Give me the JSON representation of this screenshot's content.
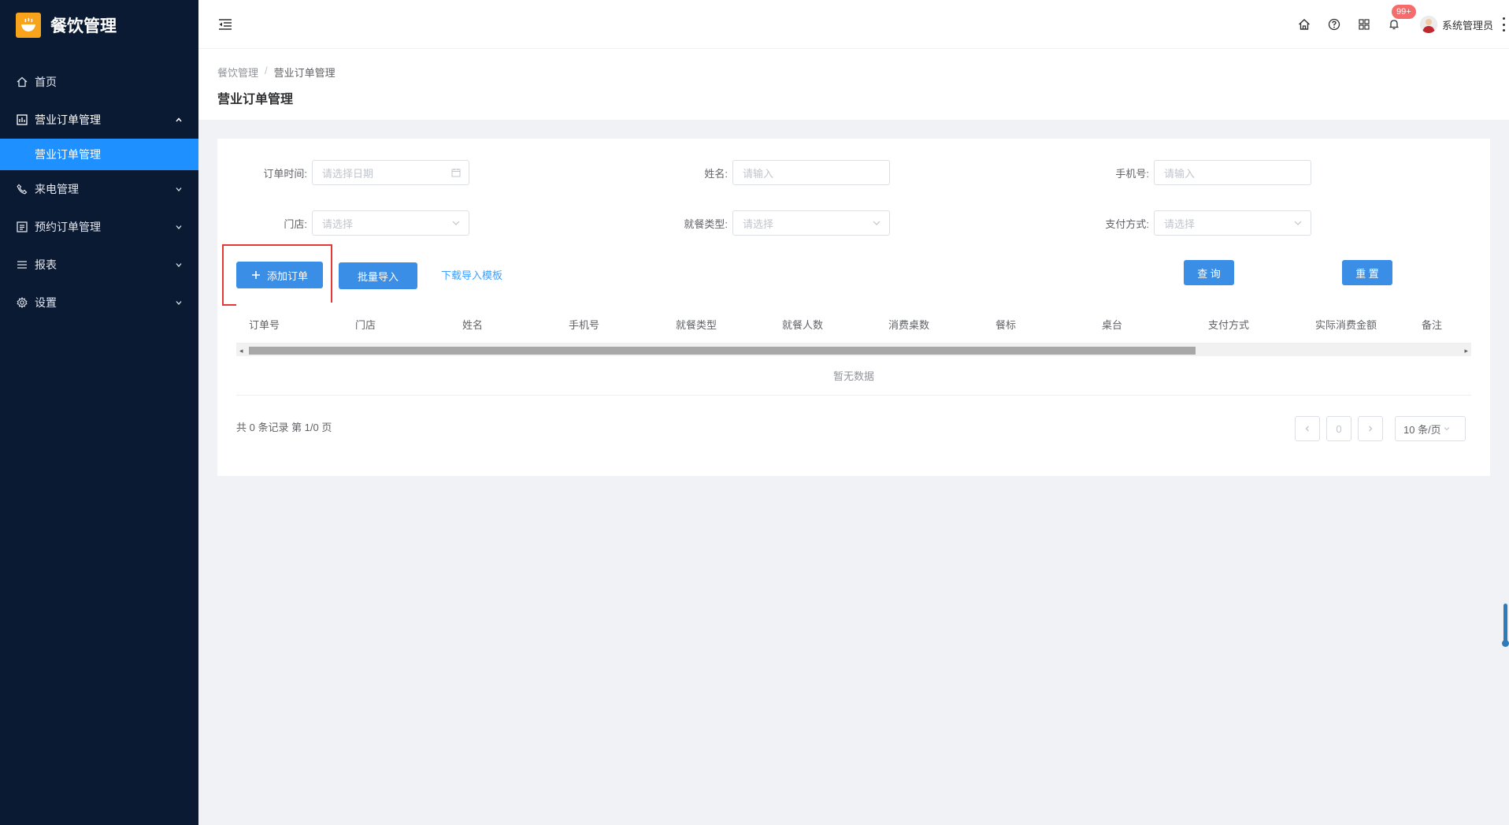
{
  "app": {
    "name": "餐饮管理"
  },
  "sidebar": {
    "items": [
      {
        "label": "首页",
        "icon": "home-icon"
      },
      {
        "label": "营业订单管理",
        "icon": "chart-icon",
        "expanded": true
      },
      {
        "label": "营业订单管理",
        "sub": true,
        "active": true
      },
      {
        "label": "来电管理",
        "icon": "phone-icon"
      },
      {
        "label": "预约订单管理",
        "icon": "list-icon"
      },
      {
        "label": "报表",
        "icon": "menu-icon"
      },
      {
        "label": "设置",
        "icon": "gear-icon"
      }
    ]
  },
  "header": {
    "notification_badge": "99+",
    "username": "系统管理员"
  },
  "breadcrumb": {
    "root": "餐饮管理",
    "separator": "/",
    "current": "营业订单管理"
  },
  "page": {
    "title": "营业订单管理"
  },
  "filters": {
    "order_time_label": "订单时间:",
    "order_time_placeholder": "请选择日期",
    "name_label": "姓名:",
    "name_placeholder": "请输入",
    "phone_label": "手机号:",
    "phone_placeholder": "请输入",
    "store_label": "门店:",
    "store_placeholder": "请选择",
    "dining_type_label": "就餐类型:",
    "dining_type_placeholder": "请选择",
    "payment_label": "支付方式:",
    "payment_placeholder": "请选择"
  },
  "actions": {
    "add_order": "添加订单",
    "batch_import": "批量导入",
    "download_template": "下载导入模板",
    "query": "查 询",
    "reset": "重 置"
  },
  "table": {
    "columns": [
      "订单号",
      "门店",
      "姓名",
      "手机号",
      "就餐类型",
      "就餐人数",
      "消费桌数",
      "餐标",
      "桌台",
      "支付方式",
      "实际消费金额",
      "备注"
    ],
    "empty_text": "暂无数据"
  },
  "pagination": {
    "summary": "共 0 条记录 第 1/0 页",
    "current_page": "0",
    "page_size": "10 条/页"
  },
  "colors": {
    "sidebar_bg": "#0b1a33",
    "active_menu": "#1e90ff",
    "primary_button": "#3a8ee6",
    "highlight_border": "#e53935",
    "badge": "#f56c6c"
  }
}
